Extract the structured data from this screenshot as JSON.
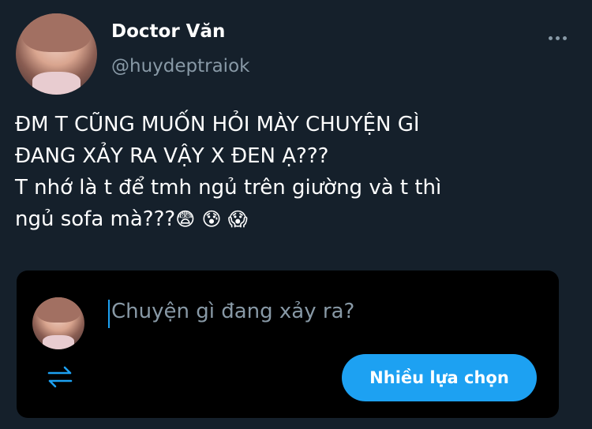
{
  "author": {
    "display_name": "Doctor Văn",
    "handle": "@huydeptraiok"
  },
  "tweet": {
    "lines": [
      "ĐM T CŨNG MUỐN HỎI MÀY CHUYỆN GÌ",
      "ĐANG XẢY RA VẬY X ĐEN Ạ???",
      "T nhớ là t để tmh ngủ trên giường và t thì"
    ],
    "last_line_text": "ngủ sofa mà???",
    "emojis": [
      "😨",
      "😰",
      "😱"
    ]
  },
  "reply": {
    "placeholder": "Chuyện gì đang xảy ra?",
    "button_label": "Nhiều lựa chọn"
  },
  "colors": {
    "background": "#15202b",
    "accent": "#1da1f2",
    "muted": "#8899a6",
    "reply_box": "#000000"
  },
  "icons": {
    "more": "more-horizontal-icon",
    "retweet": "retweet-icon"
  }
}
